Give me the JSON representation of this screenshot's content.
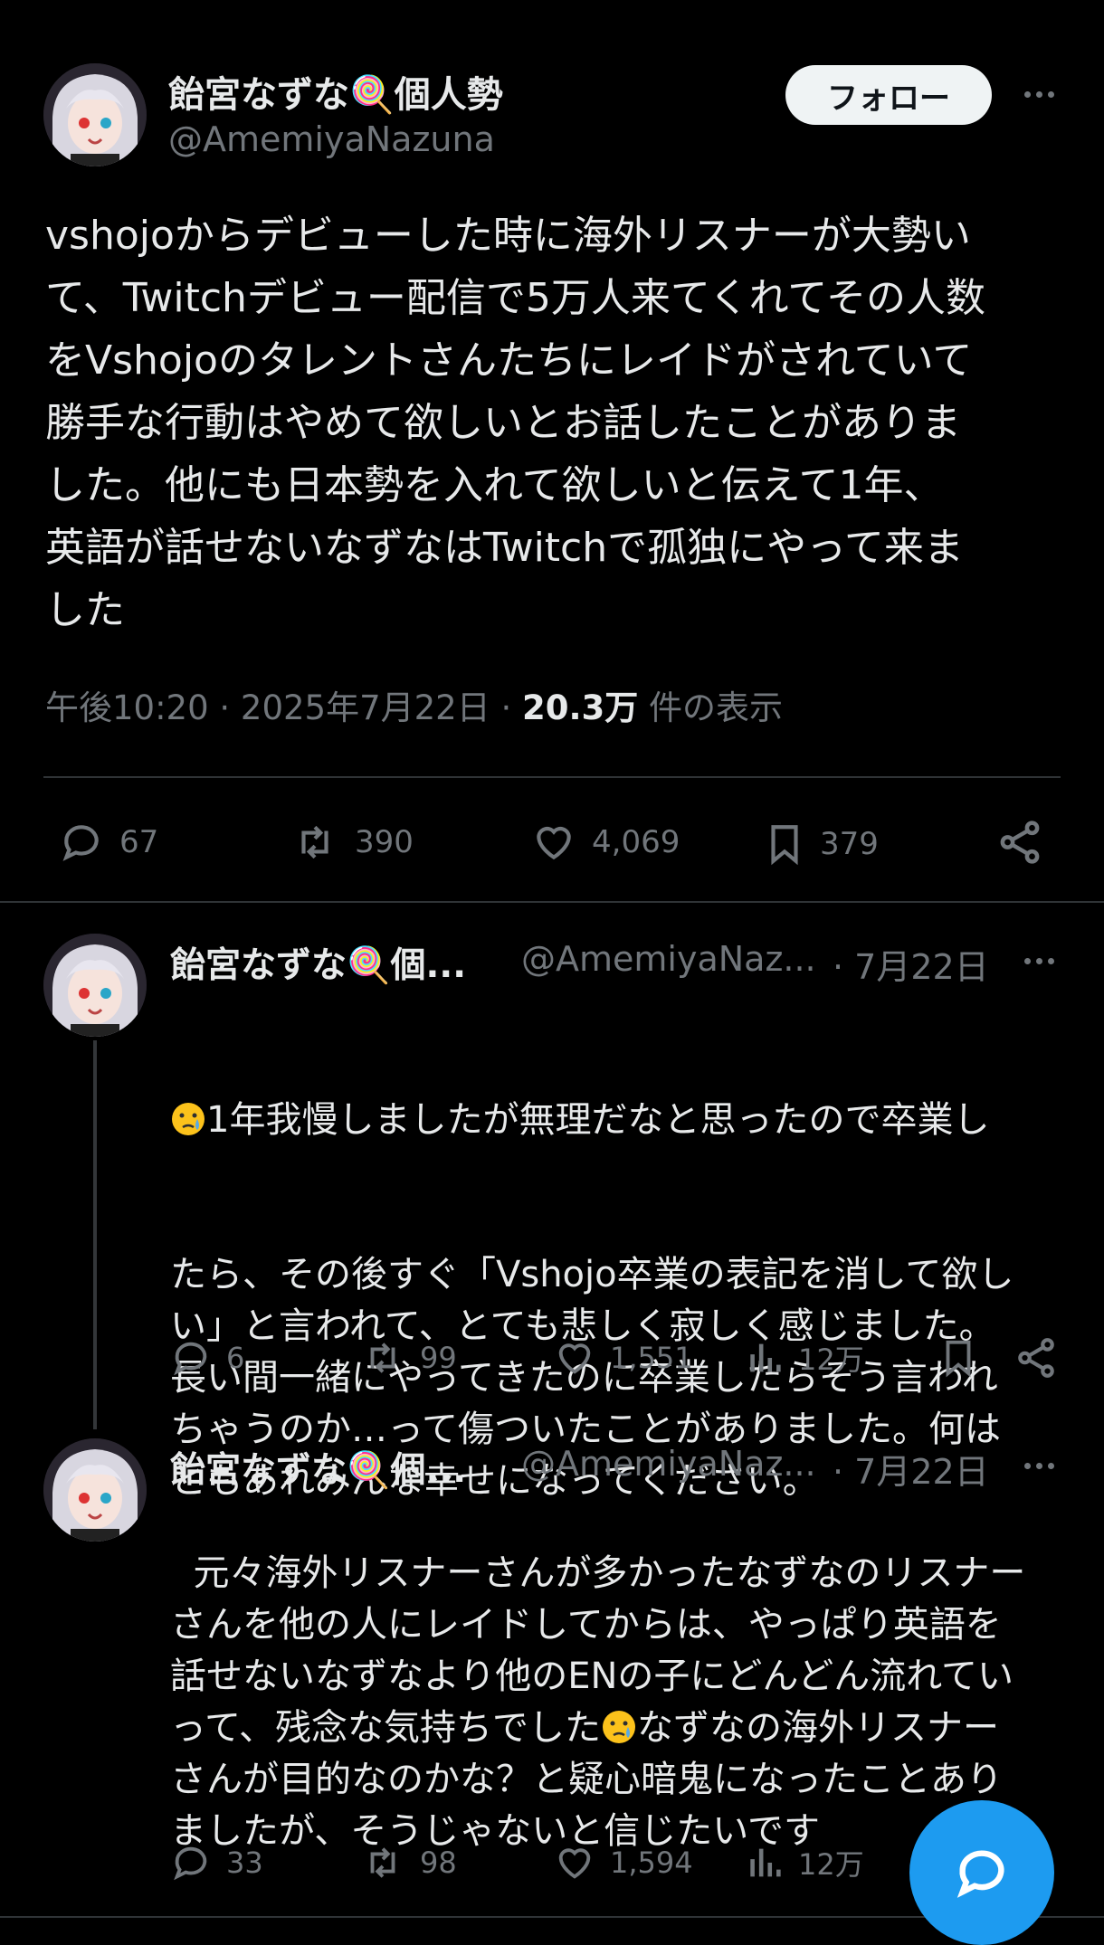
{
  "main_post": {
    "display_name": "飴宮なずな🍭個人勢",
    "handle": "@AmemiyaNazuna",
    "follow_label": "フォロー",
    "text": "vshojoからデビューした時に海外リスナーが大勢い\nて、Twitchデビュー配信で5万人来てくれてその人数\nをVshojoのタレントさんたちにレイドがされていて\n勝手な行動はやめて欲しいとお話したことがありま\nした。他にも日本勢を入れて欲しいと伝えて1年、\n英語が話せないなずなはTwitchで孤独にやって来ま\nした",
    "time": "午後10:20 · 2025年7月22日 · ",
    "views_count": "20.3万",
    "views_label": " 件の表示",
    "stats": {
      "replies": "67",
      "reposts": "390",
      "likes": "4,069",
      "bookmarks": "379"
    }
  },
  "replies": [
    {
      "display_name": "飴宮なずな🍭個...",
      "handle": "@AmemiyaNaz...",
      "date": "· 7月22日",
      "text_line1": "1年我慢しましたが無理だなと思ったので卒業し",
      "text_rest": "たら、その後すぐ「Vshojo卒業の表記を消して欲し\nい」と言われて、とても悲しく寂しく感じました。\n長い間一緒にやってきたのに卒業したらそう言われ\nちゃうのか…って傷ついたことがありました。何は\nともあれみんな幸せになってください。",
      "stats": {
        "replies": "6",
        "reposts": "99",
        "likes": "1,551",
        "views": "12万"
      }
    },
    {
      "display_name": "飴宮なずな🍭個...",
      "handle": "@AmemiyaNaz...",
      "date": "· 7月22日",
      "text_before_emoji": "元々海外リスナーさんが多かったなずなのリスナー\nさんを他の人にレイドしてからは、やっぱり英語を\n話せないなずなより他のENの子にどんどん流れてい\nって、残念な気持ちでした",
      "text_after_emoji": "なずなの海外リスナー\nさんが目的なのかな？と疑心暗鬼になったことあり\nましたが、そうじゃないと信じたいです",
      "stats": {
        "replies": "33",
        "reposts": "98",
        "likes": "1,594",
        "views": "12万"
      }
    }
  ],
  "colors": {
    "background": "#000000",
    "text": "#e7e9ea",
    "muted": "#71767b",
    "divider": "#2f3336",
    "accent": "#1d9bf0"
  }
}
